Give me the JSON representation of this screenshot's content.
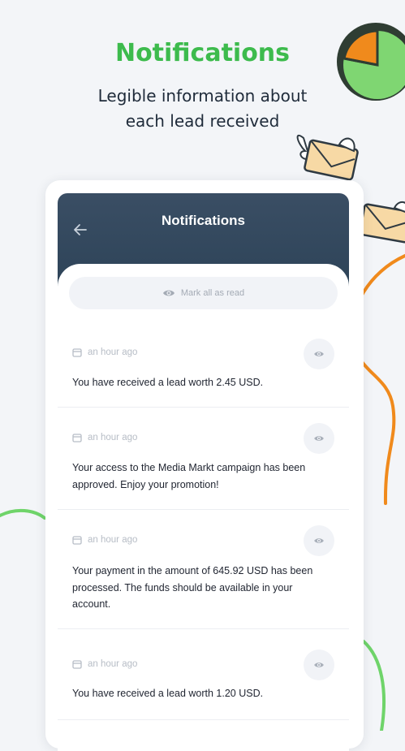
{
  "promo": {
    "title": "Notifications",
    "subtitle_line1": "Legible information about",
    "subtitle_line2": "each lead received"
  },
  "app": {
    "header_title": "Notifications",
    "mark_all_label": "Mark all as read",
    "notifications": [
      {
        "time": "an hour ago",
        "message": "You have received a lead worth 2.45 USD."
      },
      {
        "time": "an hour ago",
        "message": "Your access to the Media Markt campaign has been approved. Enjoy your promotion!"
      },
      {
        "time": "an hour ago",
        "message": "Your payment in the amount of 645.92 USD has been processed. The funds should be available in your account."
      },
      {
        "time": "an hour ago",
        "message": "You have received a lead worth 1.20 USD."
      }
    ]
  },
  "colors": {
    "accent_green": "#3dbb4d",
    "header_navy": "#2d4358",
    "decor_orange": "#f08a1c"
  },
  "icons": [
    "pie-chart-illustration",
    "flying-envelope-illustration",
    "arrow-left-icon",
    "eye-icon",
    "calendar-icon"
  ]
}
